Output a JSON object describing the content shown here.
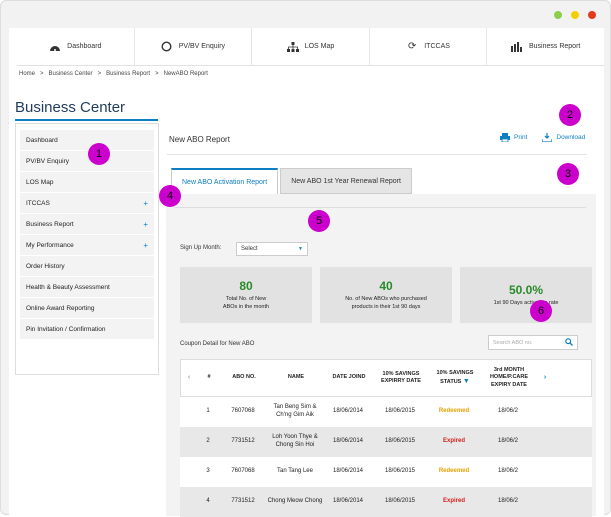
{
  "window": {
    "dots": [
      "#8ccf4a",
      "#f4d000",
      "#e23a1a"
    ]
  },
  "topnav": [
    {
      "label": "Dashboard",
      "icon": "dashboard-icon"
    },
    {
      "label": "PV/BV Enquiry",
      "icon": "circle-icon"
    },
    {
      "label": "LOS Map",
      "icon": "hierarchy-icon"
    },
    {
      "label": "ITCCAS",
      "icon": "refresh-icon"
    },
    {
      "label": "Business Report",
      "icon": "bar-chart-icon"
    }
  ],
  "breadcrumb": [
    "Home",
    ">",
    "Business Center",
    ">",
    "Business Report",
    ">",
    "NewABO Report"
  ],
  "page_title": "Business Center",
  "sidebar": [
    {
      "label": "Dashboard",
      "plus": ""
    },
    {
      "label": "PV/BV Enquiry",
      "plus": ""
    },
    {
      "label": "LOS Map",
      "plus": ""
    },
    {
      "label": "ITCCAS",
      "plus": "+"
    },
    {
      "label": "Business Report",
      "plus": "+"
    },
    {
      "label": "My Performance",
      "plus": "+"
    },
    {
      "label": "Order History",
      "plus": ""
    },
    {
      "label": "Health & Beauty Assessment",
      "plus": ""
    },
    {
      "label": "Online Award Reporting",
      "plus": ""
    },
    {
      "label": "Pin Invitation / Confirmation",
      "plus": ""
    }
  ],
  "report": {
    "title": "New ABO Report",
    "print": "Print",
    "download": "Download",
    "tabs": [
      "New ABO Activation Report",
      "New ABO 1st Year Renewal Report"
    ],
    "signup_label": "Sign Up Month:",
    "select_value": "Select",
    "cards": [
      {
        "num": "80",
        "line1": "Total No. of New",
        "line2": "ABOs in the month"
      },
      {
        "num": "40",
        "line1": "No. of New ABOs who purchased",
        "line2": "products in their 1st 90 days"
      },
      {
        "num": "50.0%",
        "line1": "1st 90 Days activation rate",
        "line2": ""
      }
    ],
    "coupon_title": "Coupon Detail for New ABO",
    "search_placeholder": "Search ABO no."
  },
  "table": {
    "headers": [
      "#",
      "ABO NO.",
      "NAME",
      "DATE JOIND",
      "10% SAVINGS EXPIRRY DATE",
      "10% SAVINGS STATUS",
      "3rd MONTH HOME/P.CARE EXPIRY DATE"
    ],
    "rows": [
      [
        "1",
        "7607068",
        "Tan Beng Sim & Ch'ng Gim Aik",
        "18/06/2014",
        "18/06/2015",
        "Redeemed",
        "18/06/2"
      ],
      [
        "2",
        "7731512",
        "Loh Yoon Thye & Chong Sin Hoi",
        "18/06/2014",
        "18/06/2015",
        "Expired",
        "18/06/2"
      ],
      [
        "3",
        "7607068",
        "Tan Tang Lee",
        "18/06/2014",
        "18/06/2015",
        "Redeemed",
        "18/06/2"
      ],
      [
        "4",
        "7731512",
        "Chong Meow Chong",
        "18/06/2014",
        "18/06/2015",
        "Expired",
        "18/06/2"
      ]
    ]
  },
  "badges": [
    "1",
    "2",
    "3",
    "4",
    "5",
    "6"
  ]
}
